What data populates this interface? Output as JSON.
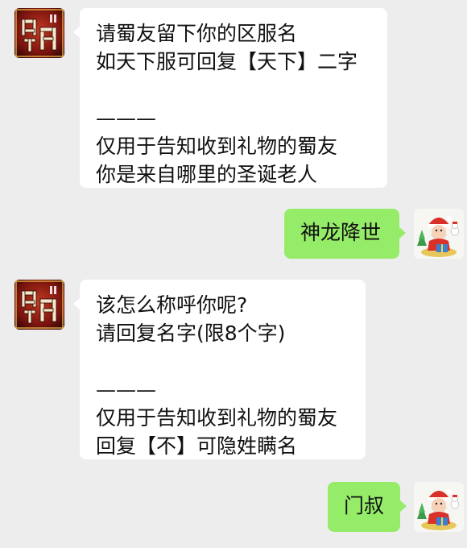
{
  "chat": {
    "messages": [
      {
        "side": "incoming",
        "avatar": "shumen-game-logo-icon",
        "lines_top": [
          "请蜀友留下你的区服名",
          "如天下服可回复【天下】二字"
        ],
        "divider": "———",
        "lines_bottom": [
          "仅用于告知收到礼物的蜀友",
          "你是来自哪里的圣诞老人"
        ]
      },
      {
        "side": "outgoing",
        "avatar": "santa-avatar-icon",
        "text": "神龙降世"
      },
      {
        "side": "incoming",
        "avatar": "shumen-game-logo-icon",
        "lines_top": [
          "该怎么称呼你呢?",
          "请回复名字(限8个字)"
        ],
        "divider": "———",
        "lines_bottom": [
          "仅用于告知收到礼物的蜀友",
          "回复【不】可隐姓瞒名"
        ]
      },
      {
        "side": "outgoing",
        "avatar": "santa-avatar-icon",
        "text": "门叔"
      }
    ]
  },
  "colors": {
    "background": "#ededed",
    "incoming_bubble": "#ffffff",
    "outgoing_bubble": "#95ec69",
    "logo_red": "#8b1a14"
  }
}
